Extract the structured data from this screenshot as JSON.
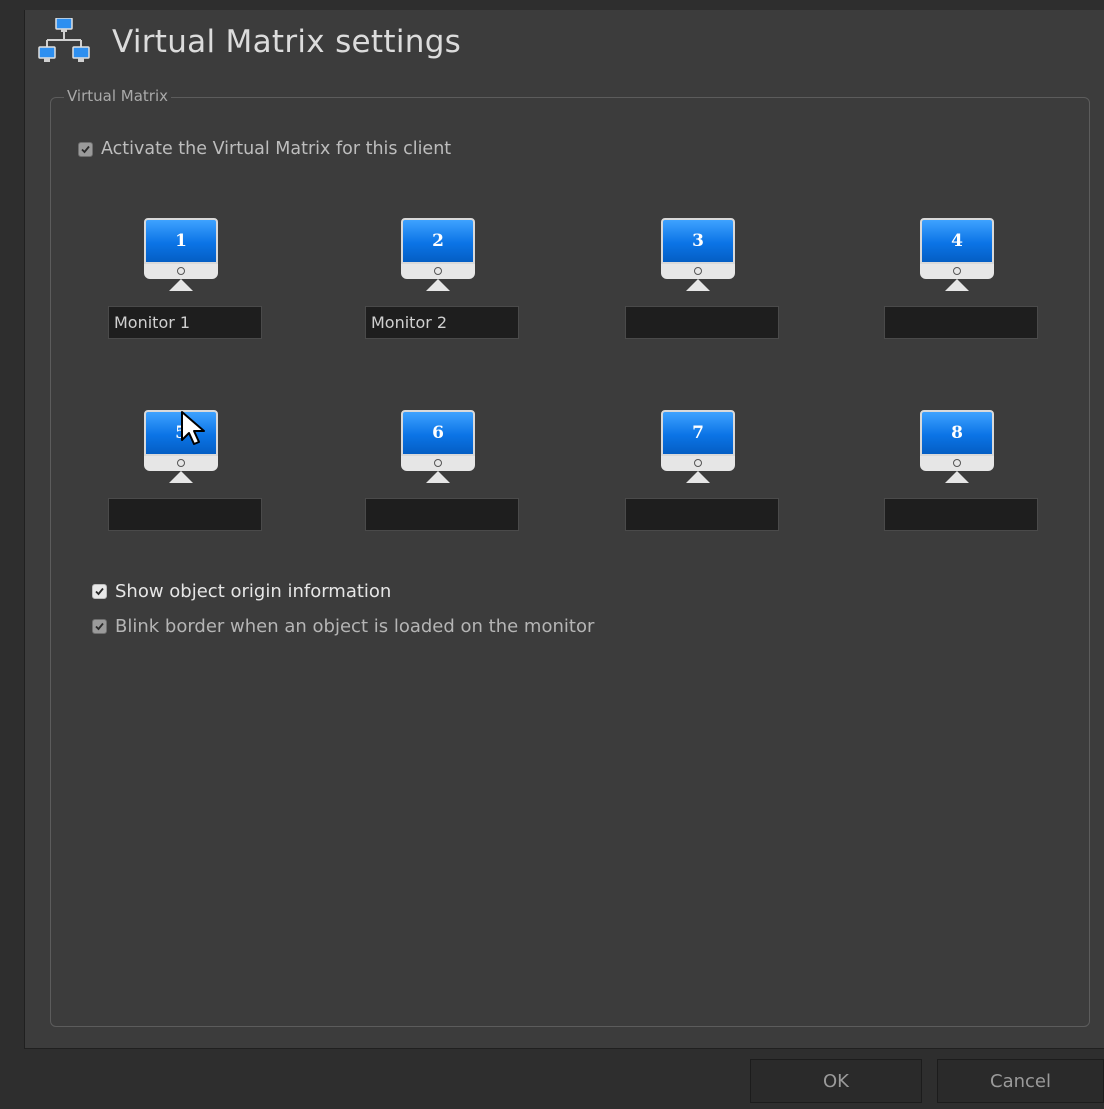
{
  "header": {
    "title": "Virtual Matrix settings",
    "icon": "network-monitors-icon"
  },
  "group": {
    "legend": "Virtual Matrix",
    "activate": {
      "label": "Activate the Virtual Matrix for this client",
      "checked": true
    }
  },
  "monitors": [
    {
      "number": "1",
      "name": "Monitor 1"
    },
    {
      "number": "2",
      "name": "Monitor 2"
    },
    {
      "number": "3",
      "name": ""
    },
    {
      "number": "4",
      "name": ""
    },
    {
      "number": "5",
      "name": ""
    },
    {
      "number": "6",
      "name": ""
    },
    {
      "number": "7",
      "name": ""
    },
    {
      "number": "8",
      "name": ""
    }
  ],
  "options": {
    "show_origin": {
      "label": "Show object origin information",
      "checked": true
    },
    "blink_border": {
      "label": "Blink border when an object is loaded on the monitor",
      "checked": true
    }
  },
  "footer": {
    "ok_label": "OK",
    "cancel_label": "Cancel"
  },
  "colors": {
    "background": "#3c3c3c",
    "screen_blue": "#0b74e6",
    "text": "#dcdcdc"
  }
}
